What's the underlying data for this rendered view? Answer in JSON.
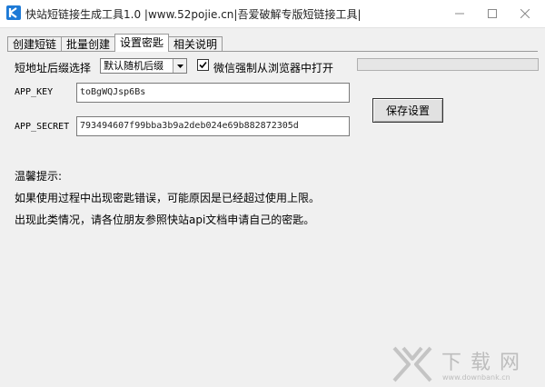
{
  "window": {
    "title": "快站短链接生成工具1.0 |www.52pojie.cn|吾爱破解专版短链接工具|",
    "icon": "app-logo-icon",
    "controls": [
      "minimize-icon",
      "maximize-icon",
      "close-icon"
    ]
  },
  "tabs": [
    {
      "label": "创建短链",
      "active": false
    },
    {
      "label": "批量创建",
      "active": false
    },
    {
      "label": "设置密匙",
      "active": true
    },
    {
      "label": "相关说明",
      "active": false
    }
  ],
  "settings": {
    "suffix_label": "短地址后缀选择",
    "suffix_value": "默认随机后缀",
    "wechat_checkbox_label": "微信强制从浏览器中打开",
    "wechat_checked": true,
    "progress_value": 0,
    "app_key_label": "APP_KEY",
    "app_key_value": "toBgWQJsp6Bs",
    "app_secret_label": "APP_SECRET",
    "app_secret_value": "793494607f99bba3b9a2deb024e69b882872305d",
    "save_button": "保存设置"
  },
  "tips": {
    "heading": "温馨提示:",
    "line1": "如果使用过程中出现密匙错误，可能原因是已经超过使用上限。",
    "line2": "出现此类情况，请各位朋友参照快站api文档申请自己的密匙。"
  },
  "watermark": {
    "text": "下载网",
    "url": "www.downbank.cn"
  },
  "colors": {
    "progress_fill": "#06b025",
    "window_bg": "#f0f0f0"
  }
}
